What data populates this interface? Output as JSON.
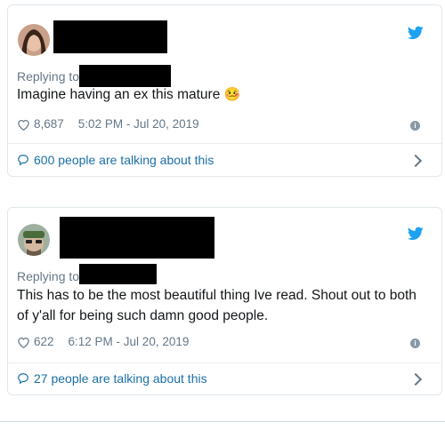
{
  "colors": {
    "twitter_blue": "#1da1f2",
    "link": "#1b6fa8",
    "muted": "#657786"
  },
  "tweets": [
    {
      "replying_label": "Replying to",
      "text": "Imagine having an ex this mature",
      "emoji": "🤒",
      "likes": "8,687",
      "timestamp": "5:02 PM - Jul 20, 2019",
      "talking": "600 people are talking about this"
    },
    {
      "replying_label": "Replying to",
      "text": "This has to be the most beautiful thing Ive read. Shout out to both of y'all for being such damn good people.",
      "likes": "622",
      "timestamp": "6:12 PM - Jul 20, 2019",
      "talking": "27 people are talking about this"
    }
  ]
}
